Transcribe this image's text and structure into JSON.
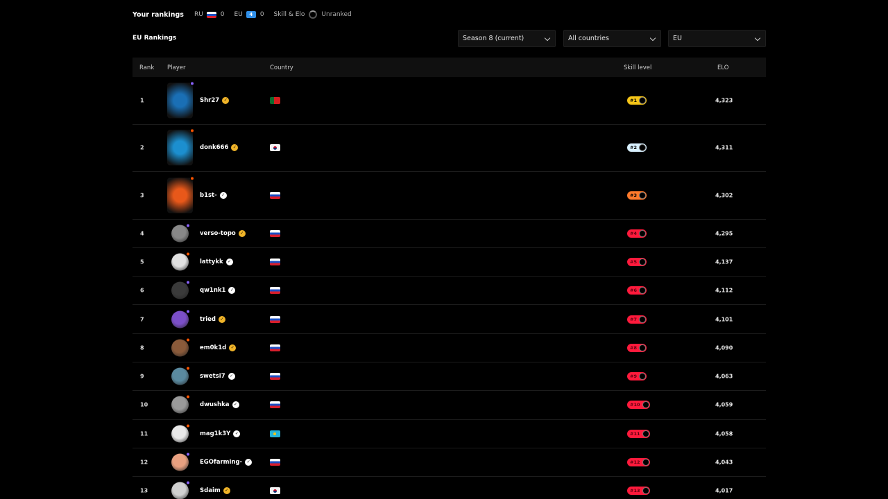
{
  "header": {
    "title": "Your rankings",
    "ru_label": "RU",
    "ru_value": "0",
    "eu_label": "EU",
    "eu_badge": "4",
    "eu_value": "0",
    "skill_label": "Skill & Elo",
    "skill_value": "Unranked"
  },
  "section_title": "EU Rankings",
  "filters": {
    "season": "Season 8 (current)",
    "country": "All countries",
    "region": "EU"
  },
  "columns": {
    "rank": "Rank",
    "player": "Player",
    "country": "Country",
    "skill": "Skill level",
    "elo": "ELO"
  },
  "rows": [
    {
      "rank": "1",
      "name": "Shr27",
      "flag": "pt",
      "badge": "#1",
      "elo": "4,323",
      "verify": "gold",
      "avatar_color": "#1a6fb5",
      "dot_color": "#8a63ff",
      "skill_color": "#f5c518"
    },
    {
      "rank": "2",
      "name": "donk666",
      "flag": "kr",
      "badge": "#2",
      "elo": "4,311",
      "verify": "gold",
      "avatar_color": "#1c8fcf",
      "dot_color": "#ff5500",
      "skill_color": "#d8f0ff"
    },
    {
      "rank": "3",
      "name": "b1st-",
      "flag": "ru",
      "badge": "#3",
      "elo": "4,302",
      "verify": "white",
      "avatar_color": "#e8581a",
      "dot_color": "#ff5500",
      "skill_color": "#ff7a2b"
    },
    {
      "rank": "4",
      "name": "verso-topo",
      "flag": "ru",
      "badge": "#4",
      "elo": "4,295",
      "verify": "gold",
      "avatar_color": "#888888",
      "dot_color": "#8a63ff",
      "skill_color": "#ff1a3c"
    },
    {
      "rank": "5",
      "name": "lattykk",
      "flag": "ru",
      "badge": "#5",
      "elo": "4,137",
      "verify": "white",
      "avatar_color": "#e0e0e0",
      "dot_color": "#ff5500",
      "skill_color": "#ff1a3c"
    },
    {
      "rank": "6",
      "name": "qw1nk1",
      "flag": "ru",
      "badge": "#6",
      "elo": "4,112",
      "verify": "white",
      "avatar_color": "#3a3a3a",
      "dot_color": "#8a63ff",
      "skill_color": "#ff1a3c"
    },
    {
      "rank": "7",
      "name": "tried",
      "flag": "ru",
      "badge": "#7",
      "elo": "4,101",
      "verify": "gold",
      "avatar_color": "#7b4fc8",
      "dot_color": "#8a63ff",
      "skill_color": "#ff1a3c"
    },
    {
      "rank": "8",
      "name": "em0k1d",
      "flag": "ru",
      "badge": "#8",
      "elo": "4,090",
      "verify": "gold",
      "avatar_color": "#8a5a3a",
      "dot_color": "#ff5500",
      "skill_color": "#ff1a3c"
    },
    {
      "rank": "9",
      "name": "swetsi7",
      "flag": "ru",
      "badge": "#9",
      "elo": "4,063",
      "verify": "white",
      "avatar_color": "#5a8aa0",
      "dot_color": "#ff5500",
      "skill_color": "#ff1a3c"
    },
    {
      "rank": "10",
      "name": "dwushka",
      "flag": "ru",
      "badge": "#10",
      "elo": "4,059",
      "verify": "white",
      "avatar_color": "#9a9a9a",
      "dot_color": "#ff5500",
      "skill_color": "#ff1a3c"
    },
    {
      "rank": "11",
      "name": "mag1k3Y",
      "flag": "kz",
      "badge": "#11",
      "elo": "4,058",
      "verify": "white",
      "avatar_color": "#e8e8e8",
      "dot_color": "#ff5500",
      "skill_color": "#ff1a3c"
    },
    {
      "rank": "12",
      "name": "EGOfarming-",
      "flag": "ru",
      "badge": "#12",
      "elo": "4,043",
      "verify": "white",
      "avatar_color": "#e8a080",
      "dot_color": "#8a63ff",
      "skill_color": "#ff1a3c"
    },
    {
      "rank": "13",
      "name": "Sdaim",
      "flag": "kr",
      "badge": "#13",
      "elo": "4,017",
      "verify": "gold",
      "avatar_color": "#d0d0d0",
      "dot_color": "#8a63ff",
      "skill_color": "#ff1a3c"
    }
  ]
}
